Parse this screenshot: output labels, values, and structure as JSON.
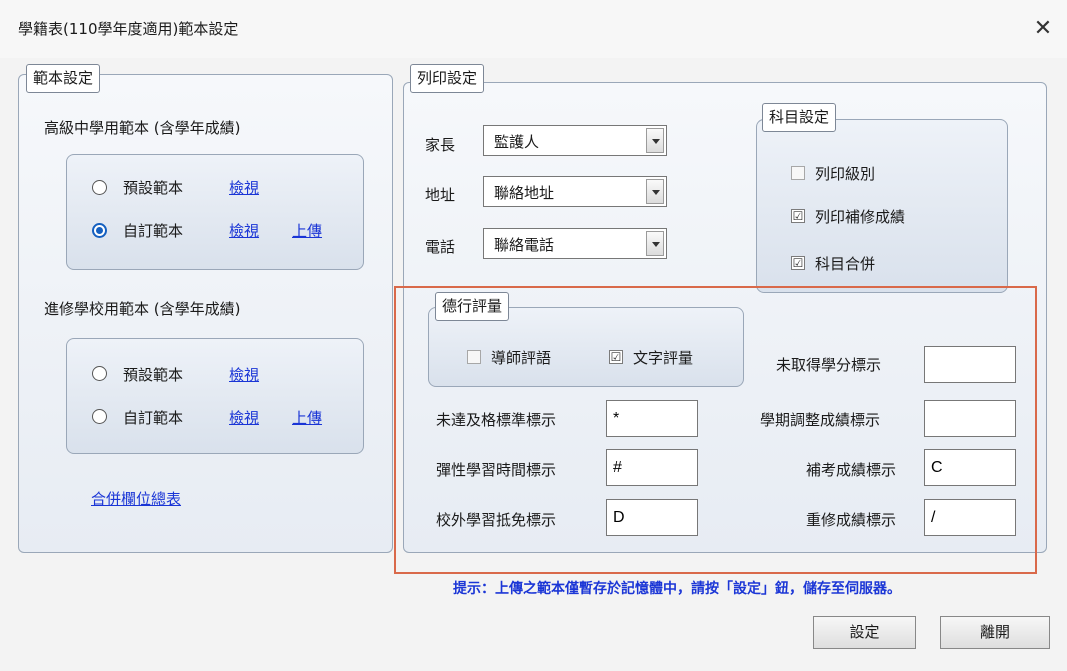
{
  "window": {
    "title": "學籍表(110學年度適用)範本設定",
    "close_glyph": "✕"
  },
  "template_settings": {
    "legend": "範本設定",
    "senior": {
      "label": "高級中學用範本 (含學年成績)",
      "default_label": "預設範本",
      "custom_label": "自訂範本",
      "view": "檢視",
      "upload": "上傳",
      "selected": "custom"
    },
    "continuing": {
      "label": "進修學校用範本 (含學年成績)",
      "default_label": "預設範本",
      "custom_label": "自訂範本",
      "view": "檢視",
      "upload": "上傳",
      "selected": "none"
    },
    "merge_link": "合併欄位總表"
  },
  "print_settings": {
    "legend": "列印設定",
    "parent": {
      "label": "家長",
      "value": "監護人"
    },
    "address": {
      "label": "地址",
      "value": "聯絡地址"
    },
    "phone": {
      "label": "電話",
      "value": "聯絡電話"
    },
    "subject": {
      "legend": "科目設定",
      "print_level": "列印級別",
      "print_makeup": "列印補修成績",
      "merge": "科目合併",
      "checks": [
        false,
        true,
        true
      ]
    },
    "conduct": {
      "legend": "德行評量",
      "tutor_comment": "導師評語",
      "text_eval": "文字評量",
      "checks": [
        false,
        true
      ]
    },
    "marks": {
      "fail": {
        "label": "未達及格標準標示",
        "value": "*"
      },
      "flex": {
        "label": "彈性學習時間標示",
        "value": "#"
      },
      "offsite": {
        "label": "校外學習抵免標示",
        "value": "D"
      },
      "no_credit": {
        "label": "未取得學分標示",
        "value": ""
      },
      "adjust": {
        "label": "學期調整成績標示",
        "value": ""
      },
      "retake_exam": {
        "label": "補考成績標示",
        "value": "C"
      },
      "repeat": {
        "label": "重修成績標示",
        "value": "/"
      }
    },
    "highlight_color": "#d9694a"
  },
  "hint": "提示：上傳之範本僅暫存於記憶體中，請按「設定」鈕，儲存至伺服器。",
  "buttons": {
    "set": "設定",
    "leave": "離開"
  },
  "check_glyph": "☑"
}
